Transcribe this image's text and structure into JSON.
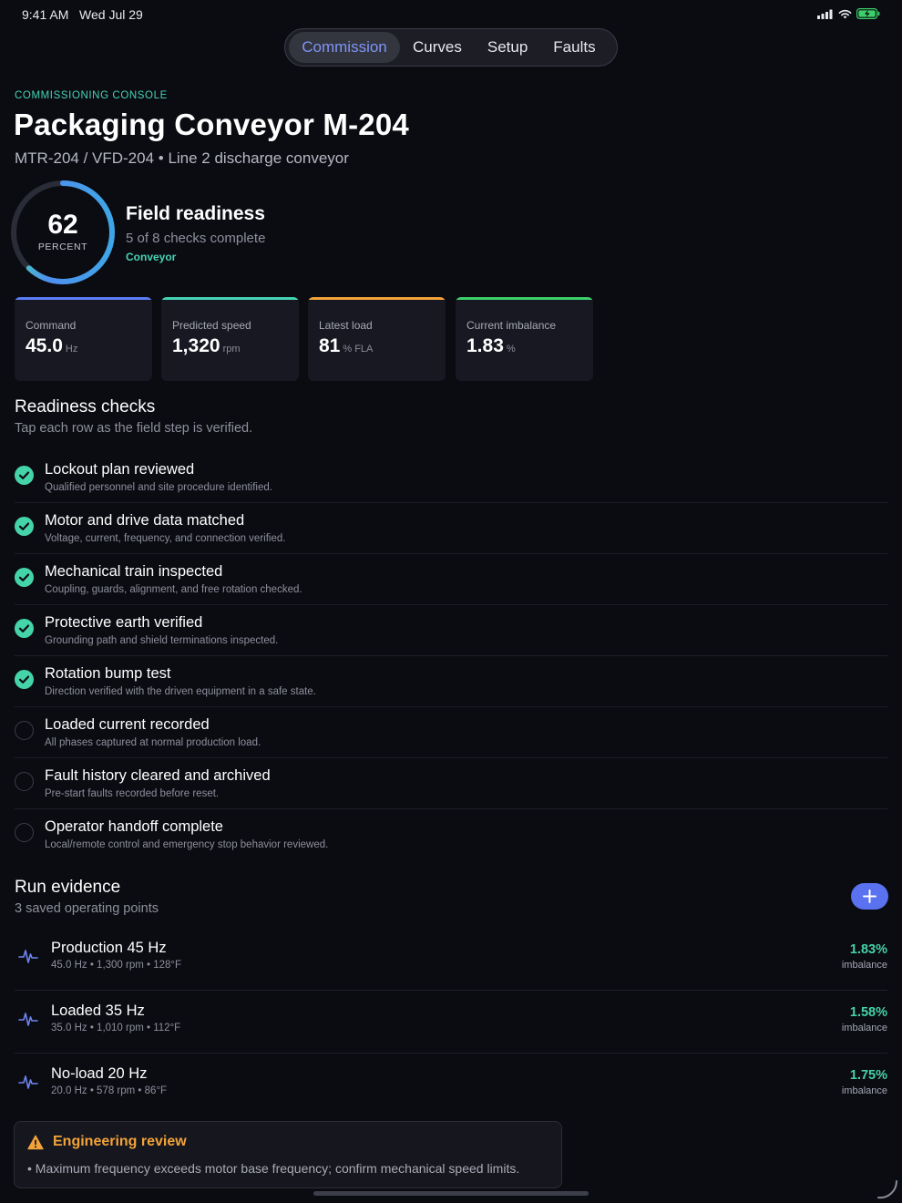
{
  "status": {
    "time": "9:41 AM",
    "date": "Wed Jul 29"
  },
  "tabs": [
    {
      "label": "Commission"
    },
    {
      "label": "Curves"
    },
    {
      "label": "Setup"
    },
    {
      "label": "Faults"
    }
  ],
  "header": {
    "eyebrow": "COMMISSIONING CONSOLE",
    "title": "Packaging Conveyor M-204",
    "subtitle": "MTR-204 / VFD-204 • Line 2 discharge conveyor"
  },
  "readiness": {
    "percent": "62",
    "percent_label": "PERCENT",
    "progress": 0.62,
    "title": "Field readiness",
    "subtitle": "5 of 8 checks complete",
    "tag": "Conveyor"
  },
  "metrics": [
    {
      "label": "Command",
      "value": "45.0",
      "unit": "Hz",
      "color": "#5b7cf5"
    },
    {
      "label": "Predicted speed",
      "value": "1,320",
      "unit": "rpm",
      "color": "#45d3b4"
    },
    {
      "label": "Latest load",
      "value": "81",
      "unit": "% FLA",
      "color": "#f2a33a"
    },
    {
      "label": "Current imbalance",
      "value": "1.83",
      "unit": "%",
      "color": "#3ccf6a"
    }
  ],
  "checks_section": {
    "title": "Readiness checks",
    "subtitle": "Tap each row as the field step is verified."
  },
  "checks": [
    {
      "title": "Lockout plan reviewed",
      "desc": "Qualified personnel and site procedure identified."
    },
    {
      "title": "Motor and drive data matched",
      "desc": "Voltage, current, frequency, and connection verified."
    },
    {
      "title": "Mechanical train inspected",
      "desc": "Coupling, guards, alignment, and free rotation checked."
    },
    {
      "title": "Protective earth verified",
      "desc": "Grounding path and shield terminations inspected."
    },
    {
      "title": "Rotation bump test",
      "desc": "Direction verified with the driven equipment in a safe state."
    },
    {
      "title": "Loaded current recorded",
      "desc": "All phases captured at normal production load."
    },
    {
      "title": "Fault history cleared and archived",
      "desc": "Pre-start faults recorded before reset."
    },
    {
      "title": "Operator handoff complete",
      "desc": "Local/remote control and emergency stop behavior reviewed."
    }
  ],
  "runs_section": {
    "title": "Run evidence",
    "subtitle": "3 saved operating points"
  },
  "runs": [
    {
      "title": "Production 45 Hz",
      "desc": "45.0 Hz • 1,300 rpm • 128°F",
      "value": "1.83%",
      "label": "imbalance"
    },
    {
      "title": "Loaded 35 Hz",
      "desc": "35.0 Hz • 1,010 rpm • 112°F",
      "value": "1.58%",
      "label": "imbalance"
    },
    {
      "title": "No-load 20 Hz",
      "desc": "20.0 Hz • 578 rpm • 86°F",
      "value": "1.75%",
      "label": "imbalance"
    }
  ],
  "review": {
    "title": "Engineering review",
    "text": "• Maximum frequency exceeds motor base frequency; confirm mechanical speed limits."
  },
  "colors": {
    "accent": "#5a72f0",
    "teal": "#45d3b4",
    "success": "#45d3a9",
    "warning": "#f2a33a"
  }
}
